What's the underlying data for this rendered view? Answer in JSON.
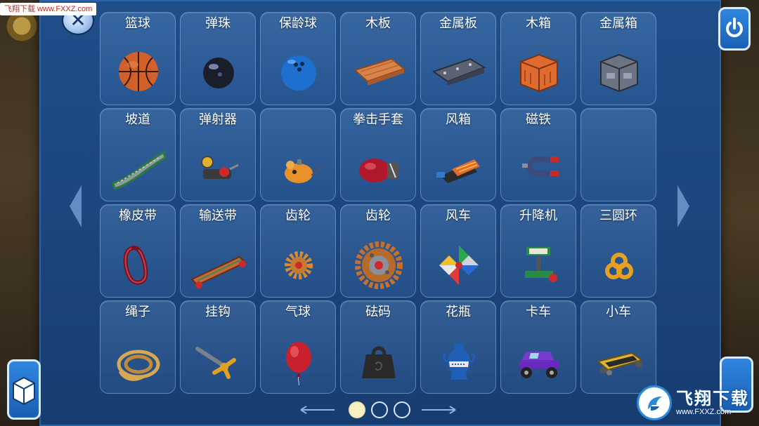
{
  "watermark_top": "飞翔下载 www.FXXZ.com",
  "watermark_bottom": {
    "title": "飞翔下载",
    "url": "www.FXXZ.com"
  },
  "items": [
    [
      {
        "label": "篮球",
        "icon": "basketball-icon"
      },
      {
        "label": "弹珠",
        "icon": "marble-icon"
      },
      {
        "label": "保龄球",
        "icon": "bowling-ball-icon"
      },
      {
        "label": "木板",
        "icon": "wood-plank-icon"
      },
      {
        "label": "金属板",
        "icon": "metal-plate-icon"
      },
      {
        "label": "木箱",
        "icon": "wooden-crate-icon"
      },
      {
        "label": "金属箱",
        "icon": "metal-crate-icon"
      }
    ],
    [
      {
        "label": "坡道",
        "icon": "ramp-icon"
      },
      {
        "label": "弹射器",
        "icon": "catapult-icon"
      },
      {
        "label": "",
        "icon": "mouse-toy-icon"
      },
      {
        "label": "拳击手套",
        "icon": "boxing-glove-icon"
      },
      {
        "label": "风箱",
        "icon": "bellows-icon"
      },
      {
        "label": "磁铁",
        "icon": "magnet-icon"
      },
      {
        "label": "",
        "icon": ""
      }
    ],
    [
      {
        "label": "橡皮带",
        "icon": "rubber-band-icon"
      },
      {
        "label": "输送带",
        "icon": "conveyor-belt-icon"
      },
      {
        "label": "齿轮",
        "icon": "small-gear-icon"
      },
      {
        "label": "齿轮",
        "icon": "large-gear-icon"
      },
      {
        "label": "风车",
        "icon": "pinwheel-icon"
      },
      {
        "label": "升降机",
        "icon": "lift-icon"
      },
      {
        "label": "三圆环",
        "icon": "triple-ring-icon"
      }
    ],
    [
      {
        "label": "绳子",
        "icon": "rope-icon"
      },
      {
        "label": "挂钩",
        "icon": "hook-icon"
      },
      {
        "label": "气球",
        "icon": "balloon-icon"
      },
      {
        "label": "砝码",
        "icon": "weight-icon"
      },
      {
        "label": "花瓶",
        "icon": "vase-icon"
      },
      {
        "label": "卡车",
        "icon": "truck-icon"
      },
      {
        "label": "小车",
        "icon": "cart-icon"
      }
    ]
  ],
  "pager": {
    "pages": 3,
    "current": 1
  },
  "colors": {
    "panel": "#1c4780",
    "tile_border": "#96c3f0",
    "active_dot": "#f7f1c2",
    "button": "#1b5fb3"
  }
}
